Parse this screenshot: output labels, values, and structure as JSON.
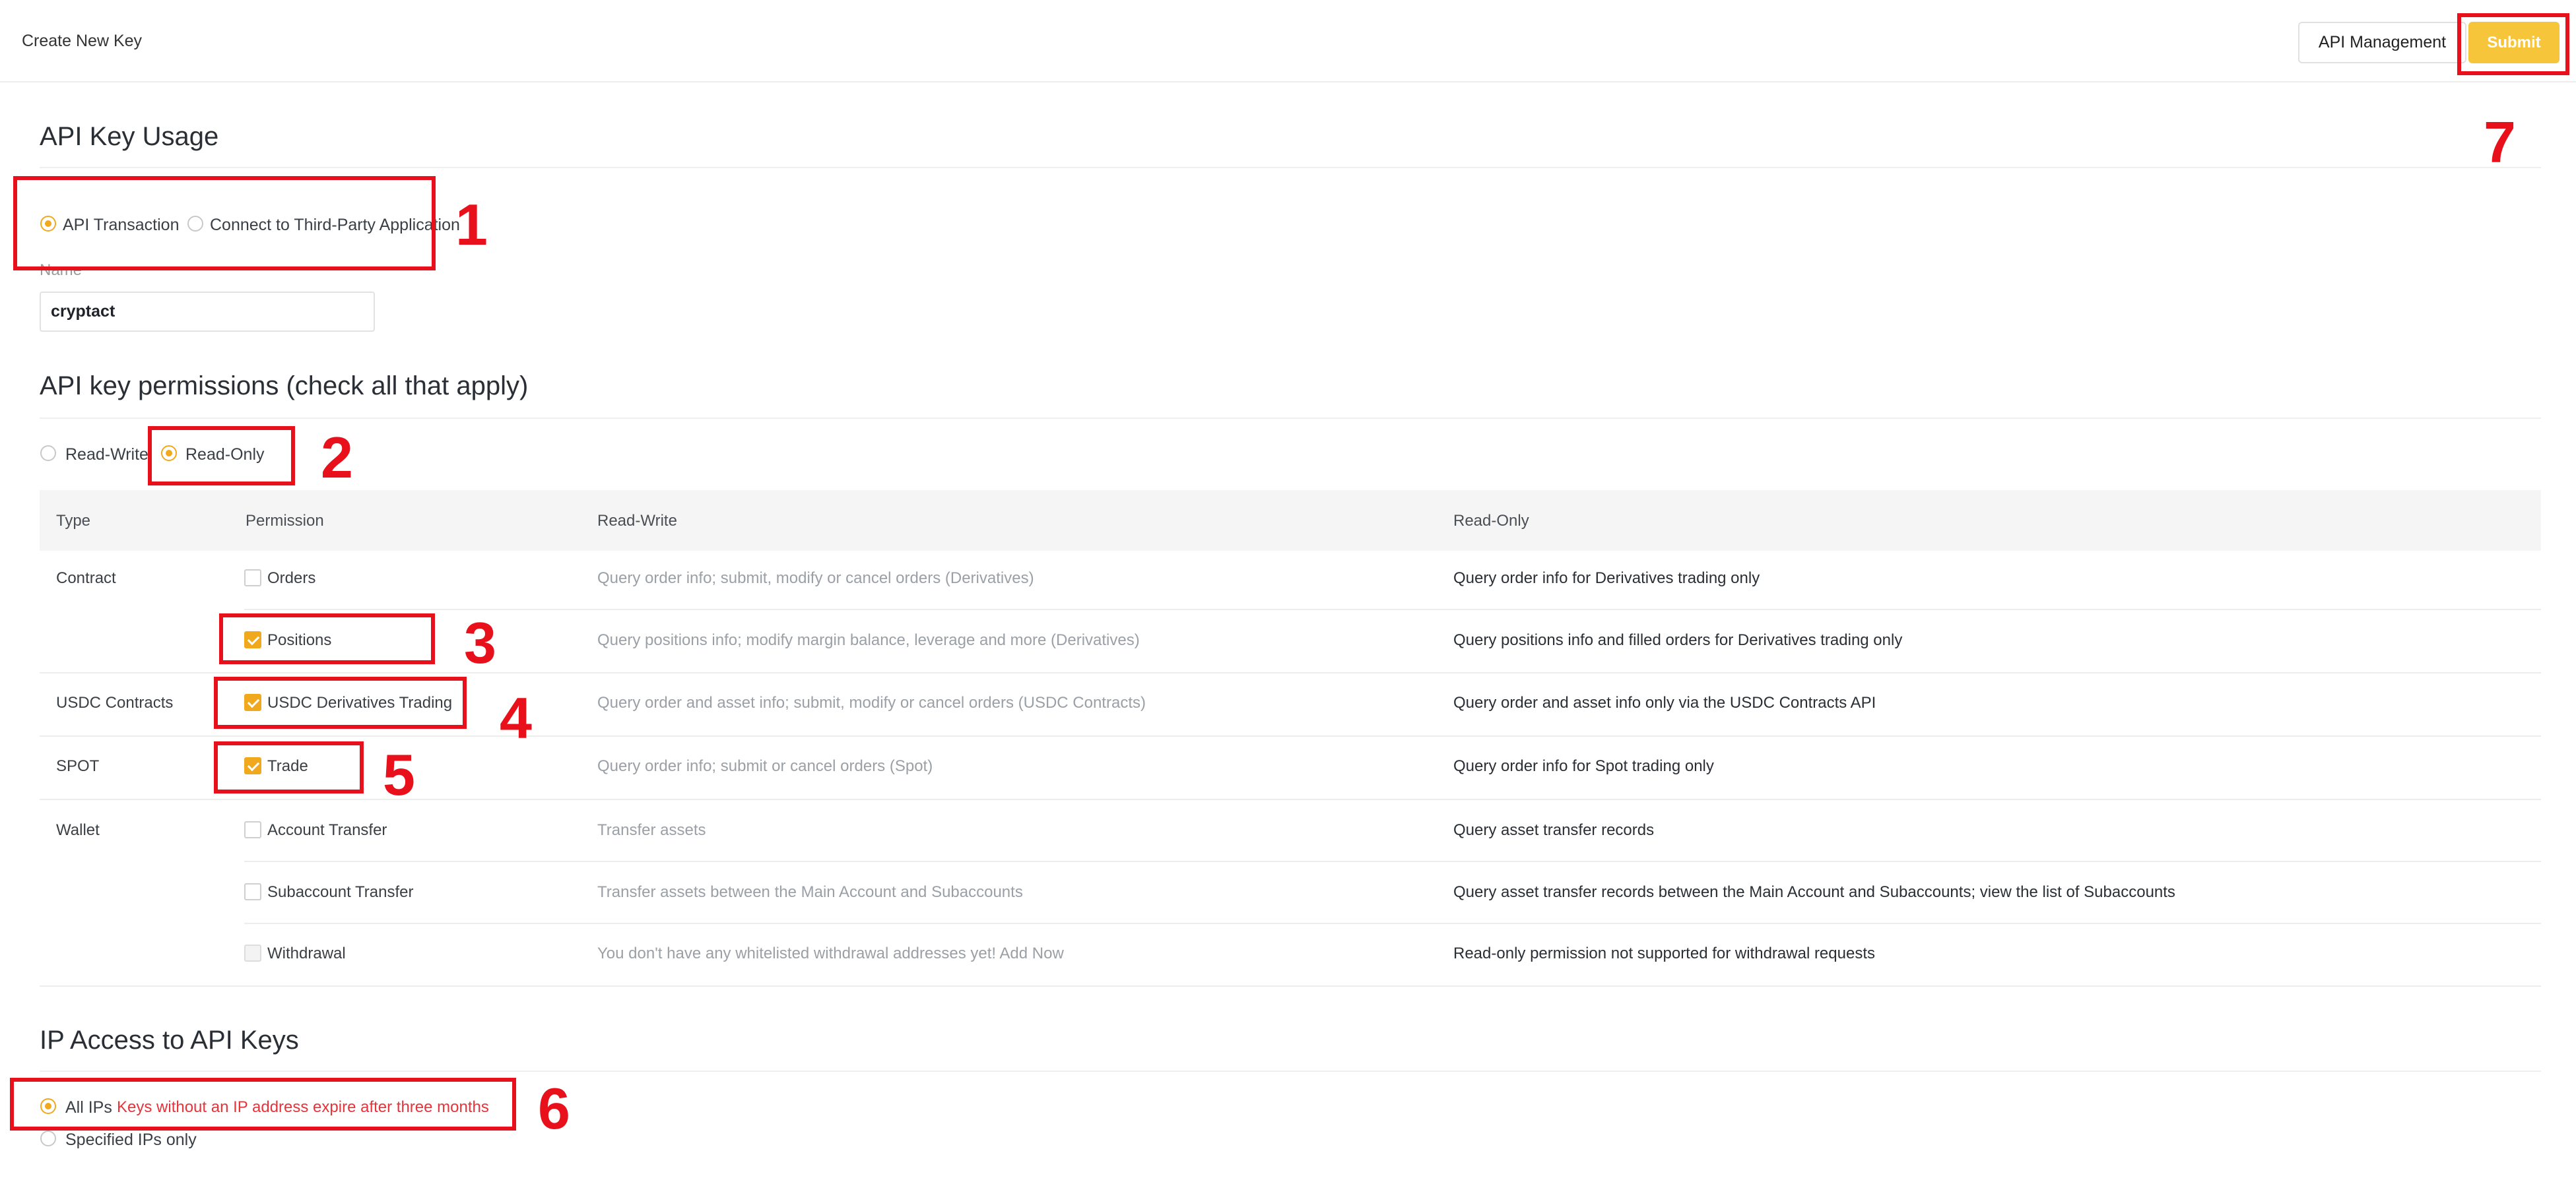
{
  "header": {
    "page_title": "Create New Key",
    "api_management_label": "API Management",
    "submit_label": "Submit"
  },
  "usage": {
    "title": "API Key Usage",
    "options": [
      "API Transaction",
      "Connect to Third-Party Application"
    ],
    "selected": "API Transaction",
    "name_label": "Name",
    "name_value": "cryptact"
  },
  "permissions": {
    "title": "API key permissions (check all that apply)",
    "modes": [
      "Read-Write",
      "Read-Only"
    ],
    "selected_mode": "Read-Only",
    "columns": [
      "Type",
      "Permission",
      "Read-Write",
      "Read-Only"
    ],
    "rows": [
      {
        "type": "Contract",
        "permission": "Orders",
        "checked": false,
        "read_write": "Query order info; submit, modify or cancel orders (Derivatives)",
        "read_only": "Query order info for Derivatives trading only"
      },
      {
        "type": "",
        "permission": "Positions",
        "checked": true,
        "read_write": "Query positions info; modify margin balance, leverage and more (Derivatives)",
        "read_only": "Query positions info and filled orders for Derivatives trading only"
      },
      {
        "type": "USDC Contracts",
        "permission": "USDC Derivatives Trading",
        "checked": true,
        "read_write": "Query order and asset info; submit, modify or cancel orders (USDC Contracts)",
        "read_only": "Query order and asset info only via the USDC Contracts API"
      },
      {
        "type": "SPOT",
        "permission": "Trade",
        "checked": true,
        "read_write": "Query order info; submit or cancel orders (Spot)",
        "read_only": "Query order info for Spot trading only"
      },
      {
        "type": "Wallet",
        "permission": "Account Transfer",
        "checked": false,
        "read_write": "Transfer assets",
        "read_only": "Query asset transfer records"
      },
      {
        "type": "",
        "permission": "Subaccount Transfer",
        "checked": false,
        "read_write": "Transfer assets between the Main Account and Subaccounts",
        "read_only": "Query asset transfer records between the Main Account and Subaccounts; view the list of Subaccounts"
      },
      {
        "type": "",
        "permission": "Withdrawal",
        "checked": false,
        "disabled": true,
        "read_write": "You don't have any whitelisted withdrawal addresses yet! Add Now",
        "read_only": "Read-only permission not supported for withdrawal requests"
      }
    ]
  },
  "ip_access": {
    "title": "IP Access to API Keys",
    "all_ips_label": "All IPs",
    "warning": "Keys without an IP address expire after three months",
    "specified_label": "Specified IPs only",
    "selected": "All IPs"
  },
  "annotations": [
    "1",
    "2",
    "3",
    "4",
    "5",
    "6",
    "7"
  ],
  "colors": {
    "accent": "#f0a91c",
    "submit": "#f7c53a",
    "annotation": "#e8101a",
    "warning": "#e5343a"
  }
}
